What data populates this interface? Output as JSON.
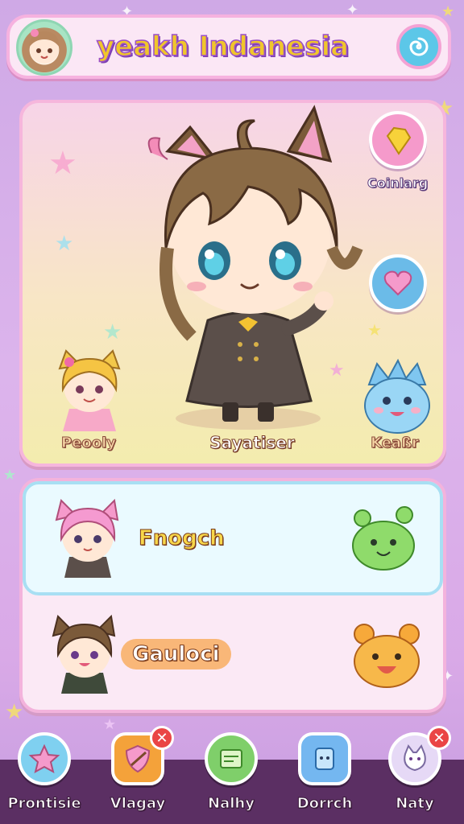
{
  "header": {
    "title": "yeakh Indanesia",
    "menu_icon": "swirl-icon"
  },
  "stage": {
    "main_character": {
      "name": "Sayatiser"
    },
    "left_character": {
      "name": "Peooly"
    },
    "right_character": {
      "name": "Keaßr"
    },
    "side_buttons": [
      {
        "label": "Coinlarg",
        "icon": "gem-icon",
        "color": "#f59acb"
      },
      {
        "label": "",
        "icon": "heart-icon",
        "color": "#6bbbe8"
      }
    ]
  },
  "roster": {
    "rows": [
      {
        "name": "Fnogch",
        "pet_color": "#8fdb6b"
      },
      {
        "name": "Gauloci",
        "pet_color": "#f7a93a"
      }
    ]
  },
  "nav": {
    "items": [
      {
        "label": "Prontisie",
        "icon": "star-icon",
        "color": "#7fd0f0"
      },
      {
        "label": "Vlagay",
        "icon": "shield-icon",
        "color": "#f4a23a",
        "badge": "✕"
      },
      {
        "label": "Nalhy",
        "icon": "map-icon",
        "color": "#7fcf6a"
      },
      {
        "label": "Dorrch",
        "icon": "card-icon",
        "color": "#74b7f0"
      },
      {
        "label": "Naty",
        "icon": "cat-face-icon",
        "color": "#e6d9f6",
        "badge": "✕"
      }
    ]
  }
}
